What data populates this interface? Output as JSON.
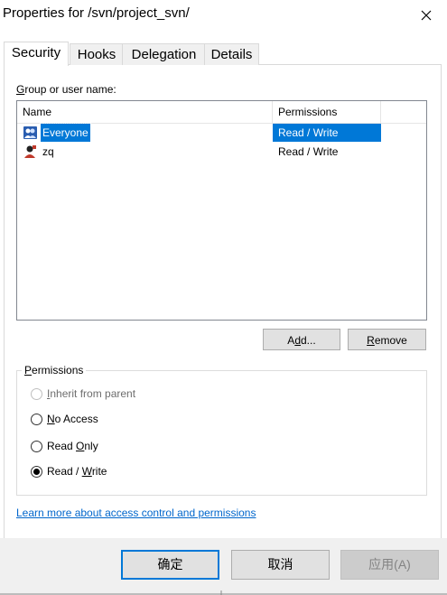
{
  "window": {
    "title": "Properties for /svn/project_svn/"
  },
  "tabs": [
    {
      "label": "Security",
      "active": true
    },
    {
      "label": "Hooks",
      "active": false
    },
    {
      "label": "Delegation",
      "active": false
    },
    {
      "label": "Details",
      "active": false
    }
  ],
  "security": {
    "group_label_first": "G",
    "group_label_rest": "roup or user name:",
    "columns": {
      "name": "Name",
      "permissions": "Permissions"
    },
    "rows": [
      {
        "name": "Everyone",
        "permissions": "Read / Write",
        "selected": true,
        "icon": "group-icon"
      },
      {
        "name": "zq",
        "permissions": "Read / Write",
        "selected": false,
        "icon": "user-icon"
      }
    ],
    "add_button": {
      "pre": "A",
      "key": "d",
      "post": "d..."
    },
    "remove_button": {
      "key": "R",
      "post": "emove"
    }
  },
  "permissions": {
    "legend_key": "P",
    "legend_rest": "ermissions",
    "options": [
      {
        "key": "I",
        "rest": "nherit from parent",
        "checked": false,
        "disabled": true
      },
      {
        "key": "N",
        "rest": "o Access",
        "checked": false,
        "disabled": false
      },
      {
        "pre": "Read ",
        "key": "O",
        "rest": "nly",
        "checked": false,
        "disabled": false
      },
      {
        "pre": "Read / ",
        "key": "W",
        "rest": "rite",
        "checked": true,
        "disabled": false
      }
    ]
  },
  "link": {
    "text": "Learn more about access control and permissions"
  },
  "footer": {
    "ok_label": "确定",
    "cancel_label": "取消",
    "apply_label": "应用(A)"
  },
  "colors": {
    "selection": "#0078d7",
    "link": "#0066cc",
    "footer_bg": "#f0f0f0"
  }
}
